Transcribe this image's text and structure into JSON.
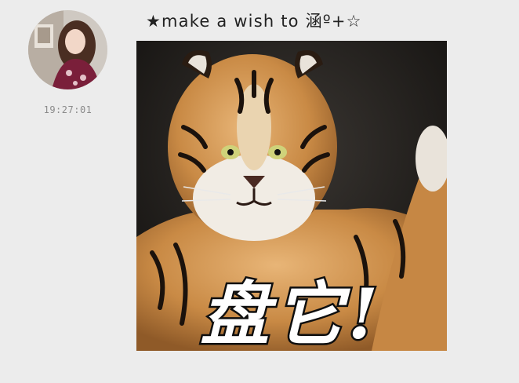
{
  "message": {
    "sender_name": "★make a wish to 涵º+☆",
    "timestamp": "19:27:01",
    "sticker_caption": "盘它!",
    "avatar_icon": "user-avatar-photo",
    "sticker_icon": "tiger-sticker-image"
  },
  "colors": {
    "background": "#ececec",
    "timestamp_text": "#8a8a8a",
    "sender_text": "#222222"
  }
}
